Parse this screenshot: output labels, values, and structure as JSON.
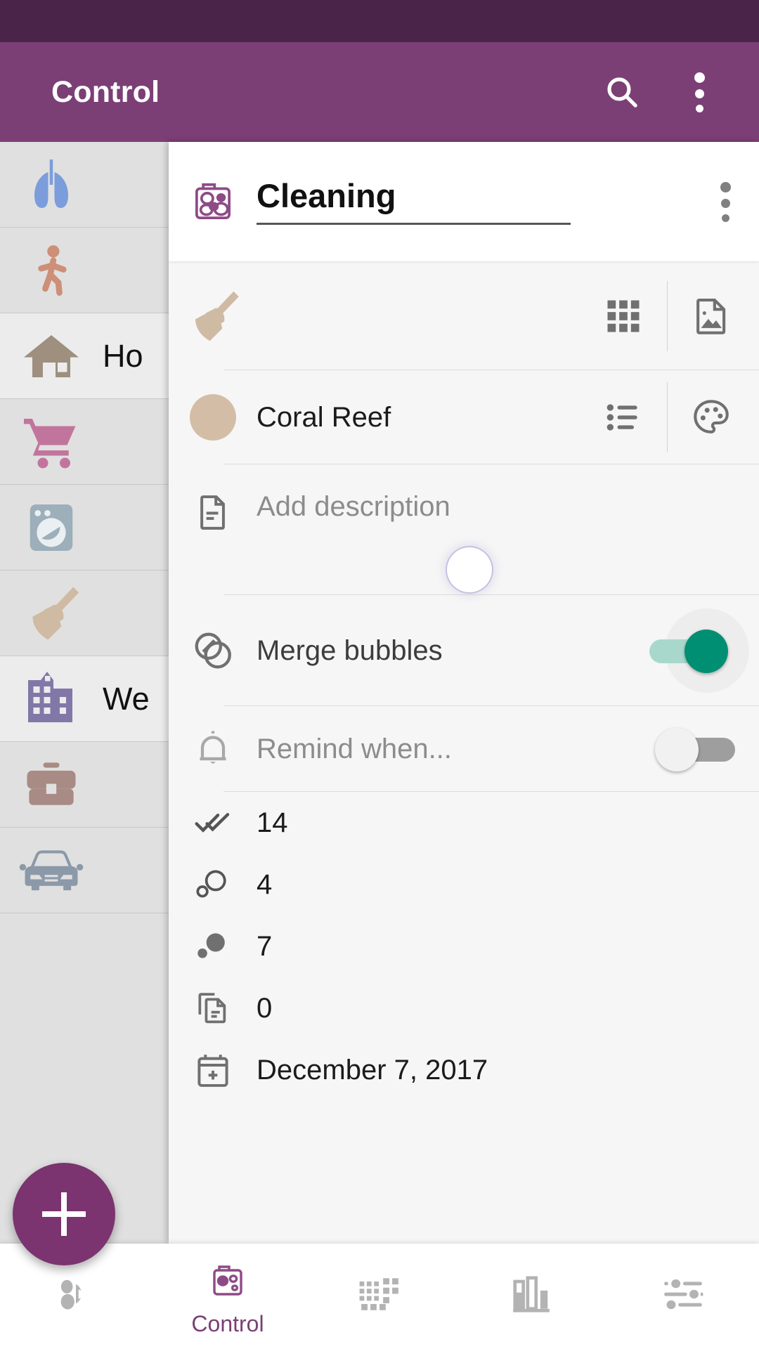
{
  "app": {
    "title": "Control",
    "accent_purple": "#7b3f76",
    "status_bar_color": "#4b2449",
    "search_icon": "search-icon",
    "overflow_icon": "overflow-menu-icon"
  },
  "sidebar": {
    "items": [
      {
        "icon": "lungs-icon",
        "label": "",
        "color": "#7b9ddb",
        "highlight": false
      },
      {
        "icon": "walking-person-icon",
        "label": "",
        "color": "#cd8f78",
        "highlight": false
      },
      {
        "icon": "house-icon",
        "label": "Ho",
        "color": "#9e8f7e",
        "highlight": true
      },
      {
        "icon": "shopping-cart-icon",
        "label": "",
        "color": "#c2759c",
        "highlight": false
      },
      {
        "icon": "washing-machine-icon",
        "label": "",
        "color": "#9cafba",
        "highlight": false
      },
      {
        "icon": "broom-icon",
        "label": "",
        "color": "#cfbaa3",
        "highlight": false
      },
      {
        "icon": "office-building-icon",
        "label": "We",
        "color": "#8278a8",
        "highlight": true
      },
      {
        "icon": "briefcase-icon",
        "label": "",
        "color": "#a88b84",
        "highlight": false
      },
      {
        "icon": "car-icon",
        "label": "",
        "color": "#8b99a8",
        "highlight": false
      }
    ]
  },
  "dialog": {
    "header": {
      "icon": "control-bubbles-icon",
      "title_value": "Cleaning",
      "title_placeholder": "Name",
      "overflow_icon": "overflow-menu-icon"
    },
    "icon_row": {
      "icon": "broom-icon",
      "icon_color": "#cfbaa3",
      "grid_action": "grid-icon",
      "image_action": "image-file-icon"
    },
    "color_row": {
      "swatch_color": "#d4bda6",
      "color_name": "Coral Reef",
      "list_action": "list-icon",
      "palette_action": "palette-icon"
    },
    "description_row": {
      "icon": "document-icon",
      "placeholder": "Add description"
    },
    "merge_row": {
      "icon": "merge-circles-icon",
      "label": "Merge bubbles",
      "enabled": true,
      "track_color": "#a8d8cc",
      "thumb_color": "#008f72"
    },
    "remind_row": {
      "icon": "bell-icon",
      "label": "Remind when...",
      "enabled": false
    },
    "stats": [
      {
        "icon": "double-check-icon",
        "value": "14"
      },
      {
        "icon": "bubbles-outline-icon",
        "value": "4"
      },
      {
        "icon": "bubbles-filled-icon",
        "value": "7"
      },
      {
        "icon": "copy-document-icon",
        "value": "0"
      },
      {
        "icon": "calendar-add-icon",
        "value": "December 7, 2017"
      }
    ]
  },
  "fab": {
    "icon": "plus-icon",
    "color": "#7b3470"
  },
  "bottom_nav": {
    "items": [
      {
        "icon": "bubbles-play-icon",
        "label": "",
        "active": false
      },
      {
        "icon": "control-bubbles-icon",
        "label": "Control",
        "active": true
      },
      {
        "icon": "dot-grid-icon",
        "label": "",
        "active": false
      },
      {
        "icon": "bar-chart-icon",
        "label": "",
        "active": false
      },
      {
        "icon": "sliders-icon",
        "label": "",
        "active": false
      }
    ]
  }
}
